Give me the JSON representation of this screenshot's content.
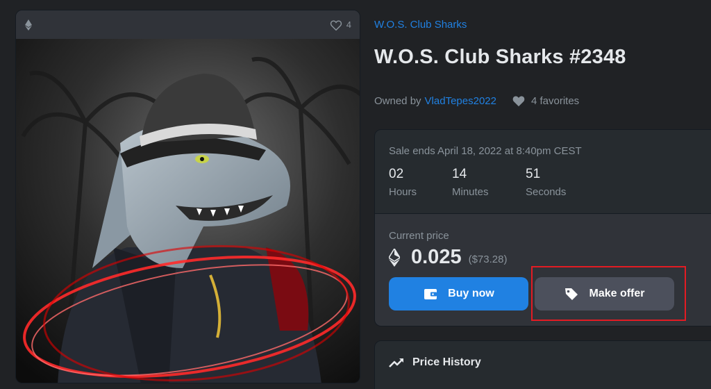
{
  "media": {
    "favorites_count": "4",
    "chain_icon": "ethereum-icon",
    "favorite_icon": "heart-outline-icon"
  },
  "item": {
    "collection": "W.O.S. Club Sharks",
    "title": "W.O.S. Club Sharks #2348",
    "owned_by_label": "Owned by",
    "owner": "VladTepes2022",
    "favorites": "4 favorites"
  },
  "sale": {
    "ends_text": "Sale ends April 18, 2022 at 8:40pm CEST",
    "countdown": [
      {
        "value": "02",
        "label": "Hours"
      },
      {
        "value": "14",
        "label": "Minutes"
      },
      {
        "value": "51",
        "label": "Seconds"
      }
    ],
    "current_price_label": "Current price",
    "price_eth": "0.025",
    "price_usd": "($73.28)",
    "buy_label": "Buy now",
    "offer_label": "Make offer"
  },
  "history": {
    "title": "Price History"
  },
  "colors": {
    "accent": "#2081e2",
    "highlight": "#e31b23",
    "background": "#202225"
  }
}
